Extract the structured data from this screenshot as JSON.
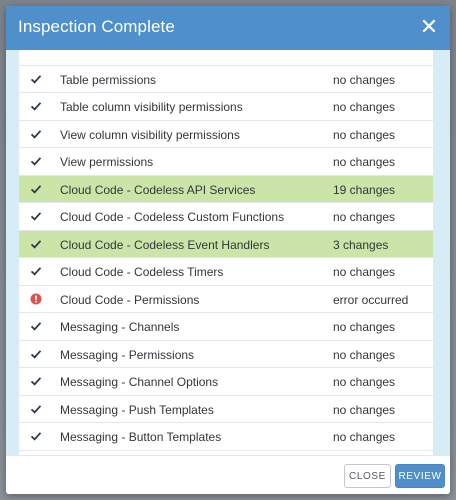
{
  "modal": {
    "title": "Inspection Complete",
    "close_icon": "close-icon"
  },
  "colors": {
    "header": "#4f8fcb",
    "highlight": "#cbe5a9",
    "error": "#d9534f",
    "check": "#2c3a4a"
  },
  "rows": [
    {
      "name": "Table permissions",
      "result": "no changes",
      "status": "check",
      "highlight": false
    },
    {
      "name": "Table column visibility permissions",
      "result": "no changes",
      "status": "check",
      "highlight": false
    },
    {
      "name": "View column visibility permissions",
      "result": "no changes",
      "status": "check",
      "highlight": false
    },
    {
      "name": "View permissions",
      "result": "no changes",
      "status": "check",
      "highlight": false
    },
    {
      "name": "Cloud Code - Codeless API Services",
      "result": "19 changes",
      "status": "check",
      "highlight": true
    },
    {
      "name": "Cloud Code - Codeless Custom Functions",
      "result": "no changes",
      "status": "check",
      "highlight": false
    },
    {
      "name": "Cloud Code - Codeless Event Handlers",
      "result": "3 changes",
      "status": "check",
      "highlight": true
    },
    {
      "name": "Cloud Code - Codeless Timers",
      "result": "no changes",
      "status": "check",
      "highlight": false
    },
    {
      "name": "Cloud Code - Permissions",
      "result": "error occurred",
      "status": "error",
      "highlight": false
    },
    {
      "name": "Messaging - Channels",
      "result": "no changes",
      "status": "check",
      "highlight": false
    },
    {
      "name": "Messaging - Permissions",
      "result": "no changes",
      "status": "check",
      "highlight": false
    },
    {
      "name": "Messaging - Channel Options",
      "result": "no changes",
      "status": "check",
      "highlight": false
    },
    {
      "name": "Messaging - Push Templates",
      "result": "no changes",
      "status": "check",
      "highlight": false
    },
    {
      "name": "Messaging - Button Templates",
      "result": "no changes",
      "status": "check",
      "highlight": false
    }
  ],
  "footer": {
    "close_label": "CLOSE",
    "review_label": "REVIEW"
  }
}
